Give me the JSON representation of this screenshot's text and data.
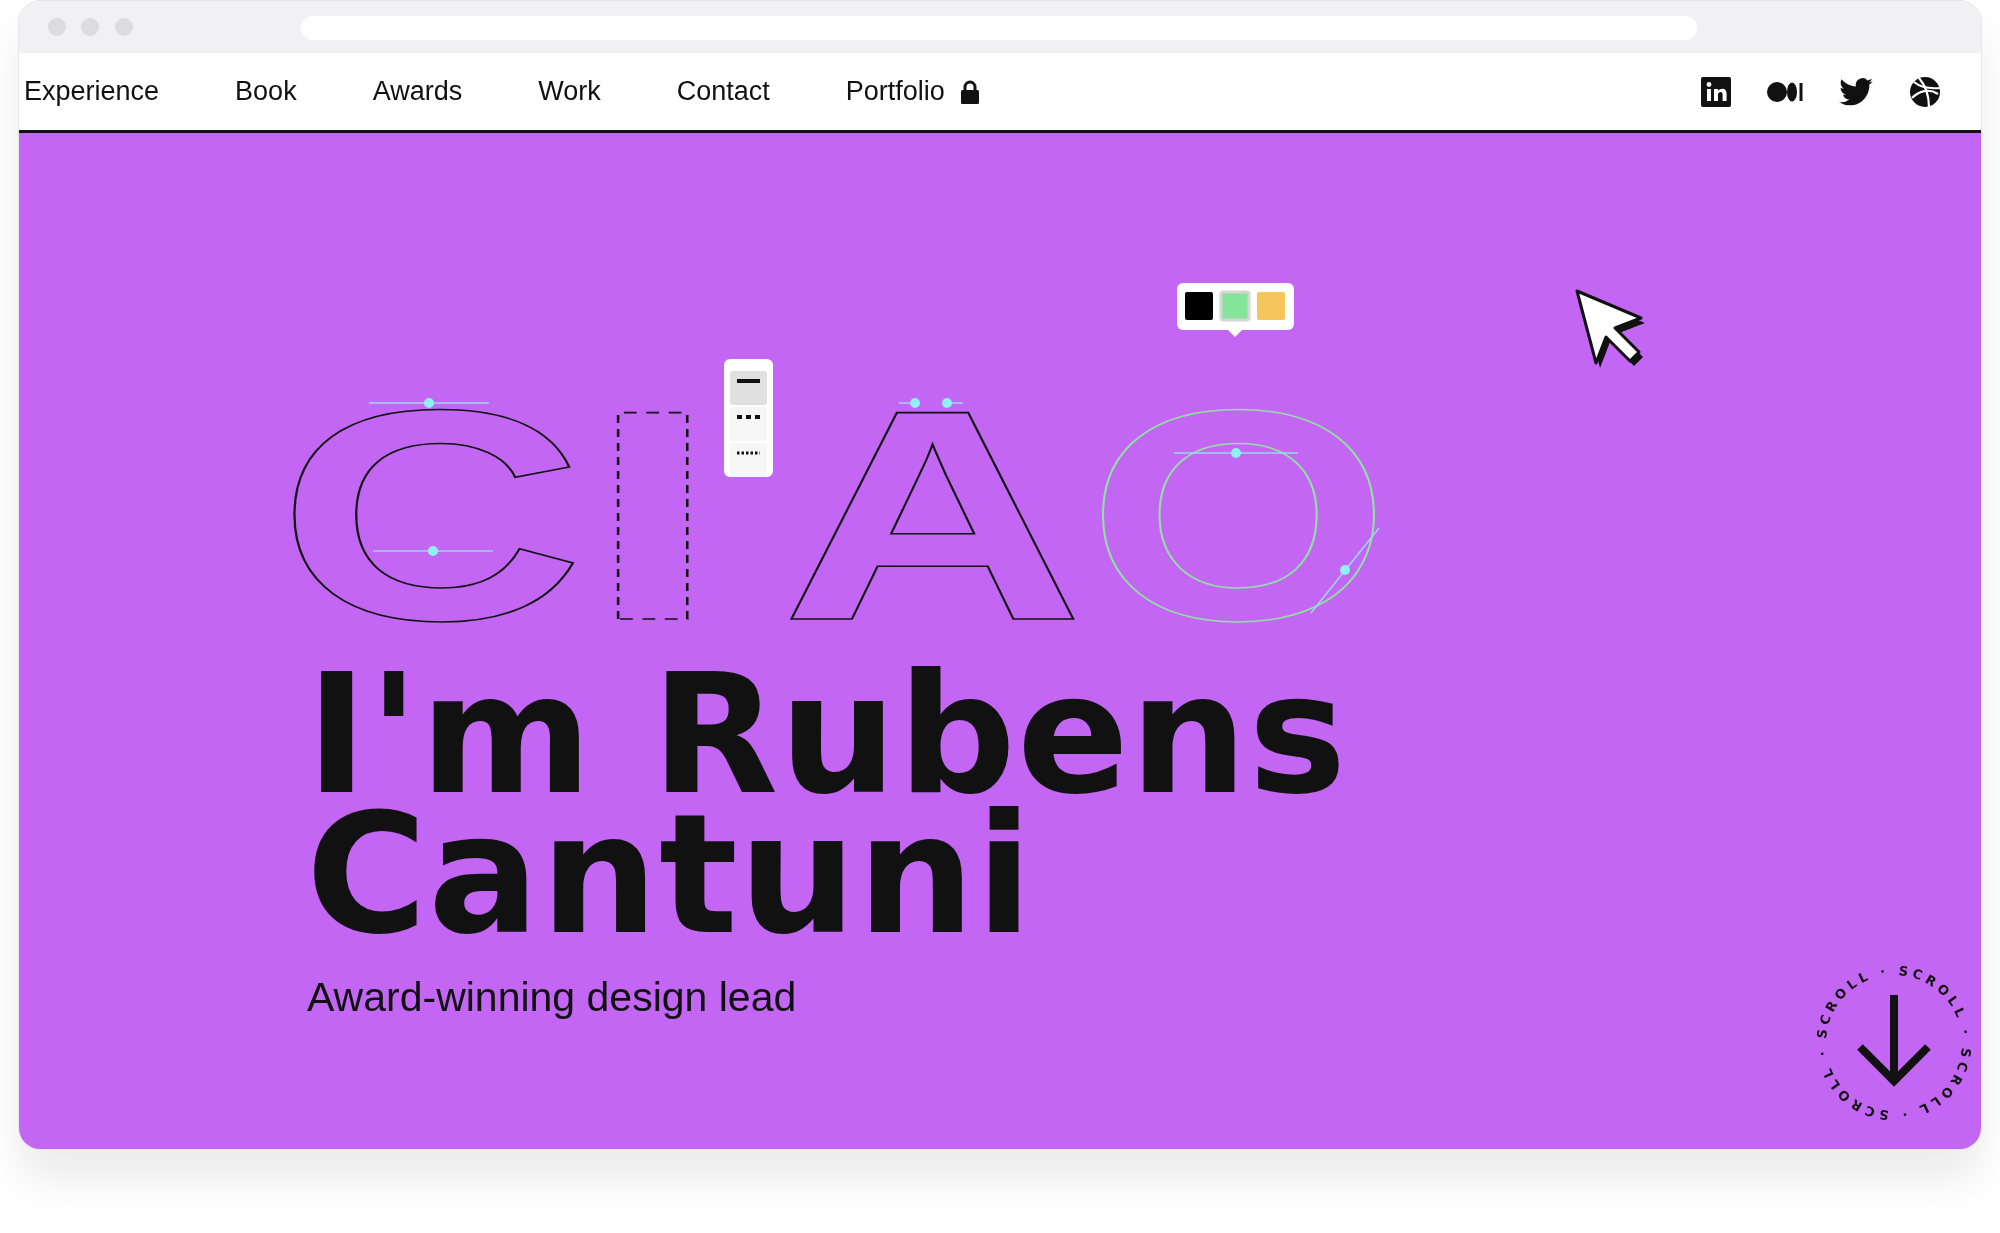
{
  "nav": {
    "items": [
      {
        "label": "Experience",
        "locked": false
      },
      {
        "label": "Book",
        "locked": false
      },
      {
        "label": "Awards",
        "locked": false
      },
      {
        "label": "Work",
        "locked": false
      },
      {
        "label": "Contact",
        "locked": false
      },
      {
        "label": "Portfolio",
        "locked": true
      }
    ]
  },
  "artwork": {
    "letters": [
      {
        "char": "C",
        "kind": "solid"
      },
      {
        "char": "I",
        "kind": "dashed"
      },
      {
        "char": "A",
        "kind": "solid"
      },
      {
        "char": "O",
        "kind": "selected"
      }
    ],
    "stroke_options": [
      {
        "kind": "solid",
        "selected": true
      },
      {
        "kind": "dashed",
        "selected": false
      },
      {
        "kind": "dotted",
        "selected": false
      }
    ],
    "swatches": [
      {
        "color": "#000000",
        "selected": false
      },
      {
        "color": "#86e39a",
        "selected": true
      },
      {
        "color": "#f5c65c",
        "selected": false
      }
    ]
  },
  "hero": {
    "headline": "I'm Rubens Cantuni",
    "subtitle": "Award-winning design lead"
  },
  "scroll_badge": {
    "text": "SCROLL · SCROLL · SCROLL · SCROLL ·"
  }
}
